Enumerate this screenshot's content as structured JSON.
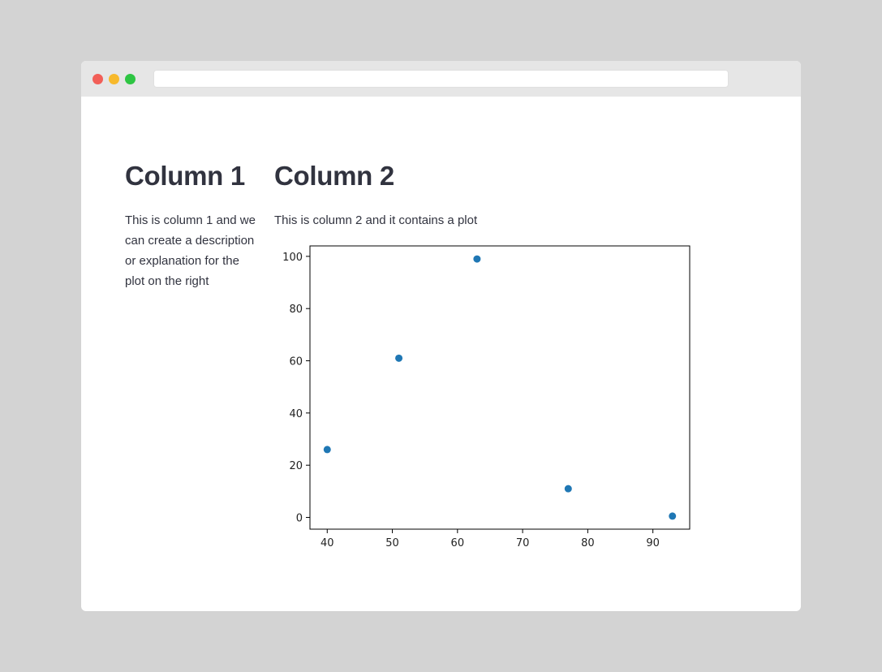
{
  "window": {
    "controls": {
      "close": "red",
      "minimize": "yellow",
      "maximize": "green"
    },
    "address": ""
  },
  "column1": {
    "title": "Column 1",
    "description": "This is column 1 and we can create a description or explanation for the plot on the right"
  },
  "column2": {
    "title": "Column 2",
    "description": "This is column 2 and it contains a plot"
  },
  "chart_data": {
    "type": "scatter",
    "title": "",
    "xlabel": "",
    "ylabel": "",
    "x": [
      40,
      51,
      63,
      77,
      93
    ],
    "y": [
      26,
      61,
      99,
      11,
      0.5
    ],
    "xlim": [
      37.35,
      95.65
    ],
    "ylim": [
      -4.5,
      104.0
    ],
    "xticks": [
      "40",
      "50",
      "60",
      "70",
      "80",
      "90"
    ],
    "yticks": [
      "0",
      "20",
      "40",
      "60",
      "80",
      "100"
    ],
    "point_color": "#1f77b4",
    "grid": false
  }
}
